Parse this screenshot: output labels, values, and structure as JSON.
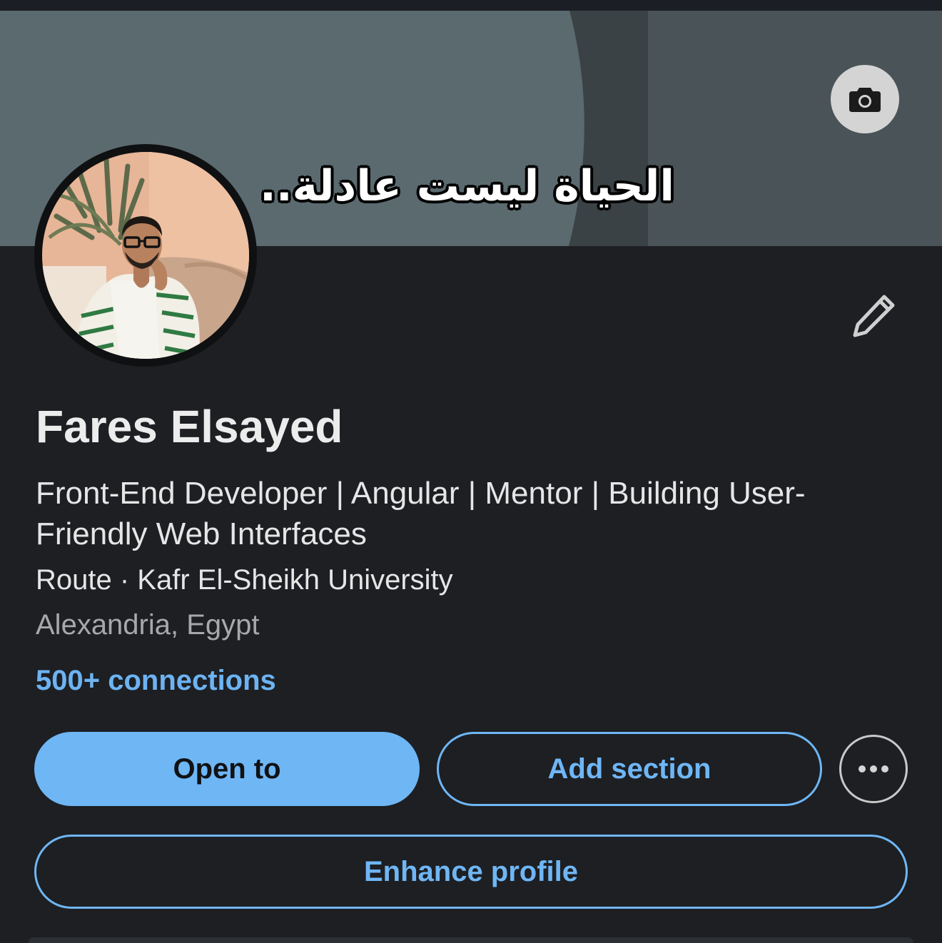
{
  "banner": {
    "caption": "الحياة ليست عادلة..",
    "camera_icon": "camera-icon"
  },
  "profile": {
    "name": "Fares Elsayed",
    "headline": "Front-End Developer | Angular | Mentor | Building User-Friendly Web Interfaces",
    "company": "Route · Kafr El-Sheikh University",
    "location": "Alexandria, Egypt",
    "connections": "500+ connections",
    "edit_icon": "pencil-icon"
  },
  "actions": {
    "open_to": "Open to",
    "add_section": "Add section",
    "more_icon": "more-horizontal-icon",
    "enhance_profile": "Enhance profile"
  },
  "colors": {
    "background": "#1d1f23",
    "accent": "#6fb6f5",
    "banner": "#4c585c"
  }
}
